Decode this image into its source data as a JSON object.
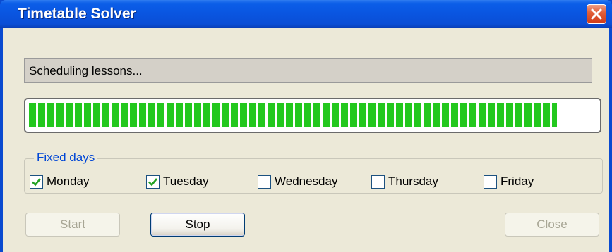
{
  "window": {
    "title": "Timetable Solver",
    "close_label": "X"
  },
  "status": {
    "text": "Scheduling lessons..."
  },
  "progress": {
    "fraction": 0.93,
    "color": "#23c81e"
  },
  "fixed_days": {
    "label": "Fixed days",
    "days": [
      {
        "label": "Monday",
        "checked": true
      },
      {
        "label": "Tuesday",
        "checked": true
      },
      {
        "label": "Wednesday",
        "checked": false
      },
      {
        "label": "Thursday",
        "checked": false
      },
      {
        "label": "Friday",
        "checked": false
      }
    ]
  },
  "buttons": {
    "start": "Start",
    "stop": "Stop",
    "close": "Close"
  },
  "colors": {
    "titlebar": "#0a55e0",
    "client": "#ece9d8",
    "accent_text": "#0046d5",
    "close_button": "#e2603a"
  }
}
